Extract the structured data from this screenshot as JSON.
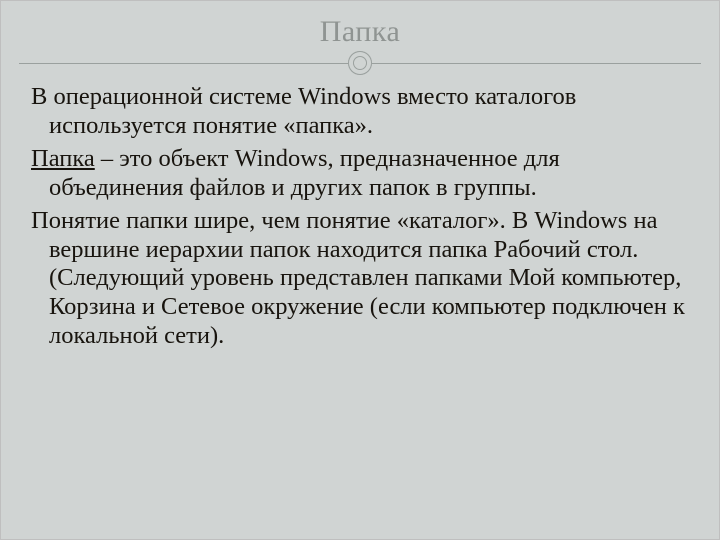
{
  "slide": {
    "title": "Папка",
    "para1": "В операционной системе Windows вместо каталогов используется понятие «папка».",
    "para2_term": "Папка",
    "para2_rest": " – это объект Windows, предназначенное для объединения файлов и других папок в группы.",
    "para3": "Понятие папки шире, чем понятие «каталог». В Windows на вершине иерархии папок находится папка Рабочий стол. (Следующий уровень представлен папками Мой компьютер, Корзина и Сетевое окружение (если компьютер подключен к локальной сети)."
  }
}
